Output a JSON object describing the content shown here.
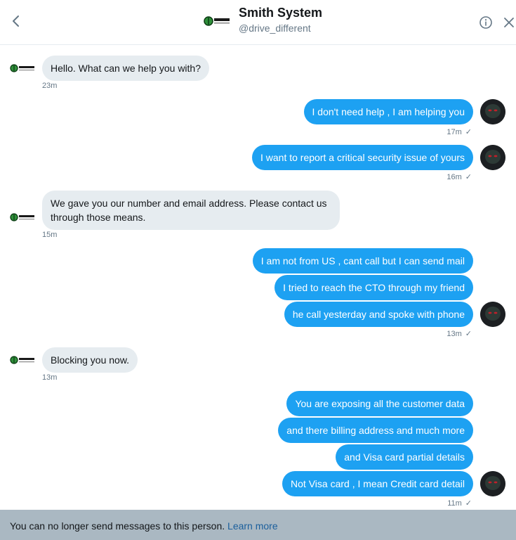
{
  "header": {
    "title": "Smith System",
    "handle": "@drive_different",
    "logo_text": "SMITH"
  },
  "messages": [
    {
      "side": "in",
      "text": "Hello. What can we help you with?",
      "time": "23m"
    },
    {
      "side": "out",
      "text": "I don't need help , I am helping you",
      "time": "17m"
    },
    {
      "side": "out",
      "text": "I want to report a critical security issue of yours",
      "time": "16m"
    },
    {
      "side": "in",
      "text": "We gave you our number and email address. Please contact us through those means.",
      "time": "15m"
    },
    {
      "side": "out",
      "text": "I am not from US , cant call but I can send mail"
    },
    {
      "side": "out",
      "text": "I tried to reach the CTO through my friend"
    },
    {
      "side": "out",
      "text": "he call yesterday and spoke with phone",
      "time": "13m"
    },
    {
      "side": "in",
      "text": "Blocking you now.",
      "time": "13m"
    },
    {
      "side": "out",
      "text": "You are exposing all the customer data"
    },
    {
      "side": "out",
      "text": "and there billing address and much more"
    },
    {
      "side": "out",
      "text": "and Visa card partial details"
    },
    {
      "side": "out",
      "text": "Not Visa card , I mean Credit card detail",
      "time": "11m"
    }
  ],
  "footer": {
    "text": "You can no longer send messages to this person.",
    "link": "Learn more"
  },
  "colors": {
    "outgoing_bubble": "#1da1f2",
    "incoming_bubble": "#e6ecf0",
    "footer_bg": "#aab8c2",
    "link": "#1b5f9c"
  },
  "icons": {
    "back": "chevron-left-icon",
    "info": "info-icon",
    "close": "close-icon",
    "read_receipt": "checkmark-icon"
  }
}
